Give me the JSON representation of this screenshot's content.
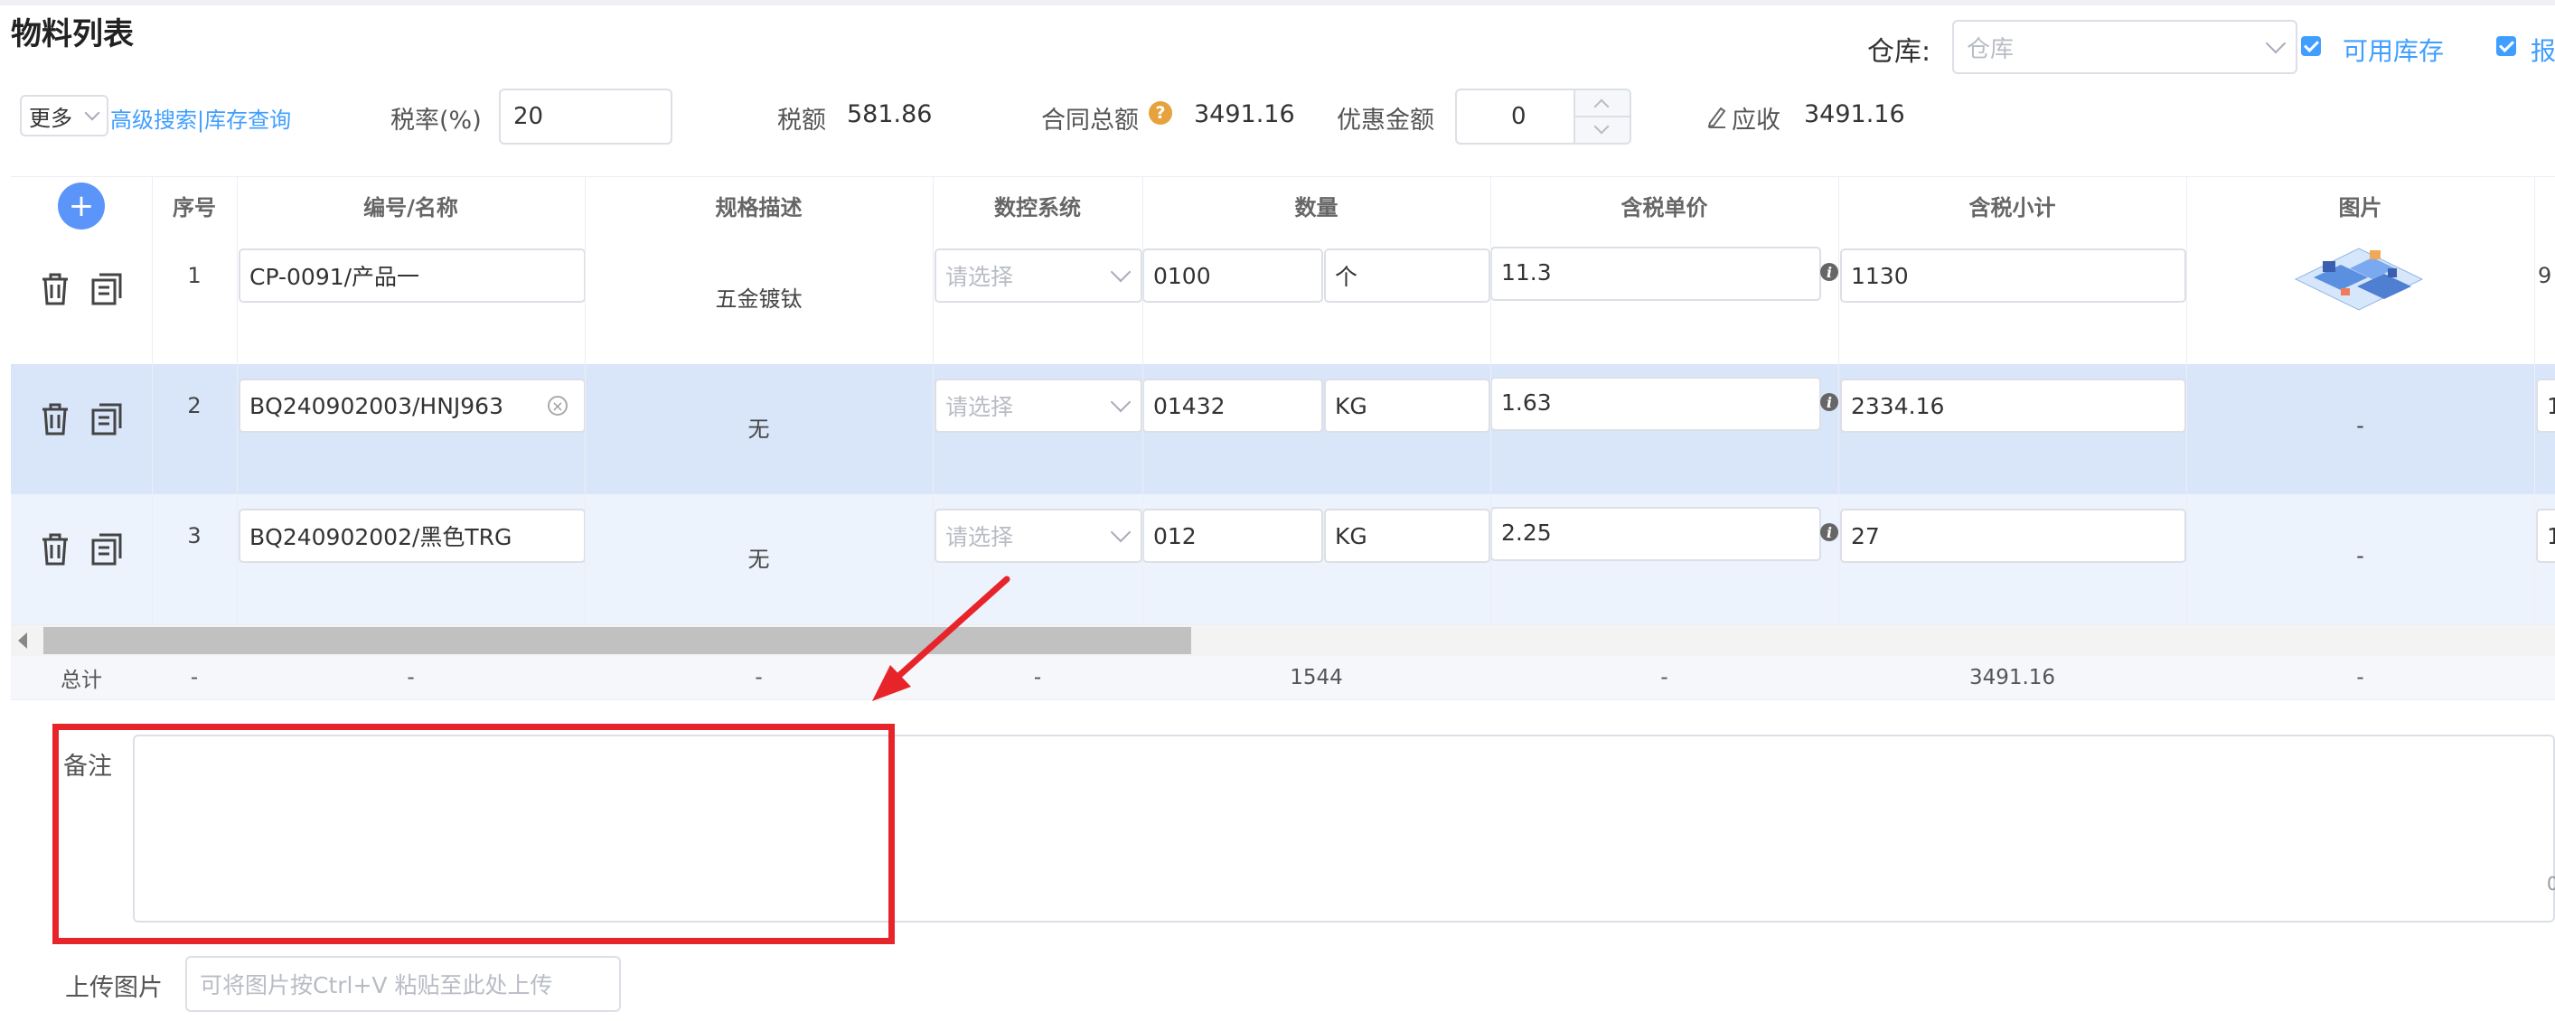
{
  "page": {
    "title": "物料列表"
  },
  "header": {
    "more_label": "更多",
    "adv_search_label": "高级搜索",
    "separator": "|",
    "stock_query_label": "库存查询",
    "tax_rate_label": "税率(%)",
    "tax_rate_value": "20",
    "tax_amount_label": "税额",
    "tax_amount_value": "581.86",
    "contract_total_label": "合同总额",
    "contract_total_value": "3491.16",
    "discount_label": "优惠金额",
    "discount_value": "0",
    "receivable_label": "应收",
    "receivable_value": "3491.16",
    "warehouse_label": "仓库:",
    "warehouse_placeholder": "仓库",
    "available_stock_label": "可用库存",
    "cut_label": "报",
    "checked_color": "#409eff"
  },
  "table": {
    "columns": [
      "序号",
      "编号/名称",
      "规格描述",
      "数控系统",
      "数量",
      "含税单价",
      "含税小计",
      "图片"
    ],
    "rows": [
      {
        "seq": "1",
        "code": "CP-0091/产品一",
        "spec": "五金镀钛",
        "cnc_placeholder": "请选择",
        "qty": "0100",
        "unit": "个",
        "price": "11.3",
        "subtotal": "1130",
        "image": "product-thumbnail",
        "extra": "9",
        "selected": false
      },
      {
        "seq": "2",
        "code": "BQ240902003/HNJ963",
        "spec": "无",
        "cnc_placeholder": "请选择",
        "qty": "01432",
        "unit": "KG",
        "price": "1.63",
        "subtotal": "2334.16",
        "image": "-",
        "extra": "1",
        "selected": true
      },
      {
        "seq": "3",
        "code": "BQ240902002/黑色TRG",
        "spec": "无",
        "cnc_placeholder": "请选择",
        "qty": "012",
        "unit": "KG",
        "price": "2.25",
        "subtotal": "27",
        "image": "-",
        "extra": "1",
        "selected": false
      }
    ],
    "summary": {
      "label": "总计",
      "seq": "-",
      "code": "-",
      "spec": "-",
      "cnc": "-",
      "qty": "1544",
      "price": "-",
      "subtotal": "3491.16",
      "image": "-"
    },
    "selected_row_color": "#d9e6fa",
    "alt_row_color": "#ecf3fd"
  },
  "remark": {
    "label": "备注",
    "value": "",
    "counter_fragment": "0"
  },
  "upload": {
    "label": "上传图片",
    "placeholder": "可将图片按Ctrl+V 粘贴至此处上传"
  },
  "annotation": {
    "color": "#e8242b"
  }
}
